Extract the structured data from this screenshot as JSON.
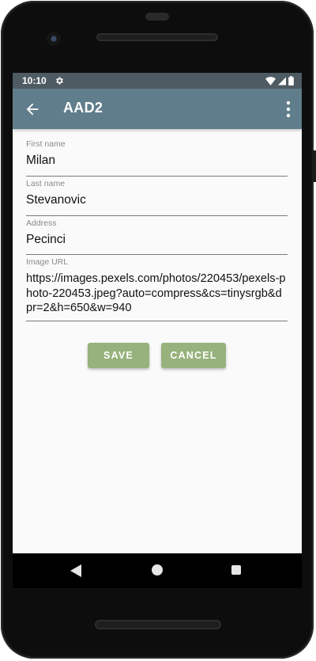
{
  "status_bar": {
    "time": "10:10",
    "icons": [
      "gear-icon",
      "wifi-icon",
      "signal-icon",
      "battery-icon"
    ]
  },
  "app_bar": {
    "title": "AAD2",
    "left_icon": "arrow-back-icon",
    "right_icon": "more-vert-icon"
  },
  "form": {
    "first_name": {
      "label": "First name",
      "value": "Milan"
    },
    "last_name": {
      "label": "Last name",
      "value": "Stevanovic"
    },
    "address": {
      "label": "Address",
      "value": "Pecinci"
    },
    "image_url": {
      "label": "Image URL",
      "value": "https://images.pexels.com/photos/220453/pexels-photo-220453.jpeg?auto=compress&cs=tinysrgb&dpr=2&h=650&w=940"
    }
  },
  "buttons": {
    "save_label": "SAVE",
    "cancel_label": "CANCEL"
  },
  "colors": {
    "status_bar": "#4f5b62",
    "app_bar": "#607d8b",
    "button": "#97b27c"
  },
  "nav_bar": {
    "icons": [
      "nav-back-icon",
      "nav-home-icon",
      "nav-recents-icon"
    ]
  }
}
